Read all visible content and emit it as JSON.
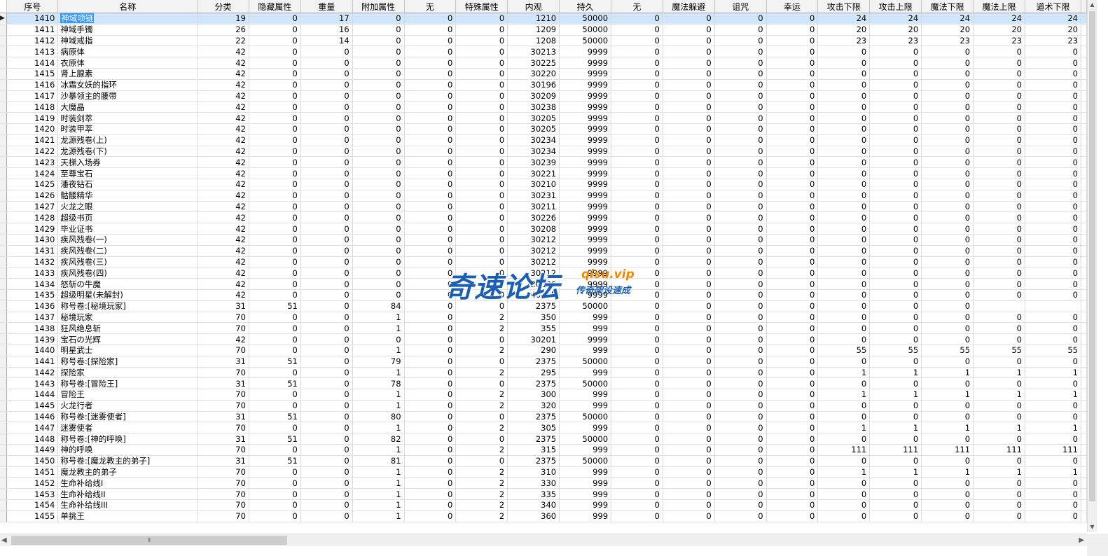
{
  "columns": [
    "序号",
    "名称",
    "分类",
    "隐藏属性",
    "重量",
    "附加属性",
    "无",
    "特殊属性",
    "内观",
    "持久",
    "无",
    "魔法躲避",
    "诅咒",
    "幸运",
    "攻击下限",
    "攻击上限",
    "魔法下限",
    "魔法上限",
    "道术下限"
  ],
  "active_row_index": 0,
  "rows": [
    [
      "1410",
      "神域项链",
      "19",
      "0",
      "17",
      "0",
      "0",
      "0",
      "1210",
      "50000",
      "0",
      "0",
      "0",
      "0",
      "24",
      "24",
      "24",
      "24",
      "24"
    ],
    [
      "1411",
      "神域手镯",
      "26",
      "0",
      "16",
      "0",
      "0",
      "0",
      "1209",
      "50000",
      "0",
      "0",
      "0",
      "0",
      "20",
      "20",
      "20",
      "20",
      "20"
    ],
    [
      "1412",
      "神域戒指",
      "22",
      "0",
      "14",
      "0",
      "0",
      "0",
      "1208",
      "50000",
      "0",
      "0",
      "0",
      "0",
      "23",
      "23",
      "23",
      "23",
      "23"
    ],
    [
      "1413",
      "病原体",
      "42",
      "0",
      "0",
      "0",
      "0",
      "0",
      "30213",
      "9999",
      "0",
      "0",
      "0",
      "0",
      "0",
      "0",
      "0",
      "0",
      "0"
    ],
    [
      "1414",
      "衣原体",
      "42",
      "0",
      "0",
      "0",
      "0",
      "0",
      "30225",
      "9999",
      "0",
      "0",
      "0",
      "0",
      "0",
      "0",
      "0",
      "0",
      "0"
    ],
    [
      "1415",
      "肾上腺素",
      "42",
      "0",
      "0",
      "0",
      "0",
      "0",
      "30220",
      "9999",
      "0",
      "0",
      "0",
      "0",
      "0",
      "0",
      "0",
      "0",
      "0"
    ],
    [
      "1416",
      "冰霜女妖的指环",
      "42",
      "0",
      "0",
      "0",
      "0",
      "0",
      "30196",
      "9999",
      "0",
      "0",
      "0",
      "0",
      "0",
      "0",
      "0",
      "0",
      "0"
    ],
    [
      "1417",
      "沙暴领主的腰带",
      "42",
      "0",
      "0",
      "0",
      "0",
      "0",
      "30209",
      "9999",
      "0",
      "0",
      "0",
      "0",
      "0",
      "0",
      "0",
      "0",
      "0"
    ],
    [
      "1418",
      "大魔晶",
      "42",
      "0",
      "0",
      "0",
      "0",
      "0",
      "30238",
      "9999",
      "0",
      "0",
      "0",
      "0",
      "0",
      "0",
      "0",
      "0",
      "0"
    ],
    [
      "1419",
      "时装剑萃",
      "42",
      "0",
      "0",
      "0",
      "0",
      "0",
      "30205",
      "9999",
      "0",
      "0",
      "0",
      "0",
      "0",
      "0",
      "0",
      "0",
      "0"
    ],
    [
      "1420",
      "时装甲萃",
      "42",
      "0",
      "0",
      "0",
      "0",
      "0",
      "30205",
      "9999",
      "0",
      "0",
      "0",
      "0",
      "0",
      "0",
      "0",
      "0",
      "0"
    ],
    [
      "1421",
      "龙源残卷(上)",
      "42",
      "0",
      "0",
      "0",
      "0",
      "0",
      "30234",
      "9999",
      "0",
      "0",
      "0",
      "0",
      "0",
      "0",
      "0",
      "0",
      "0"
    ],
    [
      "1422",
      "龙源残卷(下)",
      "42",
      "0",
      "0",
      "0",
      "0",
      "0",
      "30234",
      "9999",
      "0",
      "0",
      "0",
      "0",
      "0",
      "0",
      "0",
      "0",
      "0"
    ],
    [
      "1423",
      "天梯入场券",
      "42",
      "0",
      "0",
      "0",
      "0",
      "0",
      "30239",
      "9999",
      "0",
      "0",
      "0",
      "0",
      "0",
      "0",
      "0",
      "0",
      "0"
    ],
    [
      "1424",
      "至尊宝石",
      "42",
      "0",
      "0",
      "0",
      "0",
      "0",
      "30221",
      "9999",
      "0",
      "0",
      "0",
      "0",
      "0",
      "0",
      "0",
      "0",
      "0"
    ],
    [
      "1425",
      "潘夜钻石",
      "42",
      "0",
      "0",
      "0",
      "0",
      "0",
      "30210",
      "9999",
      "0",
      "0",
      "0",
      "0",
      "0",
      "0",
      "0",
      "0",
      "0"
    ],
    [
      "1426",
      "骷髅精华",
      "42",
      "0",
      "0",
      "0",
      "0",
      "0",
      "30231",
      "9999",
      "0",
      "0",
      "0",
      "0",
      "0",
      "0",
      "0",
      "0",
      "0"
    ],
    [
      "1427",
      "火龙之眼",
      "42",
      "0",
      "0",
      "0",
      "0",
      "0",
      "30211",
      "9999",
      "0",
      "0",
      "0",
      "0",
      "0",
      "0",
      "0",
      "0",
      "0"
    ],
    [
      "1428",
      "超级书页",
      "42",
      "0",
      "0",
      "0",
      "0",
      "0",
      "30226",
      "9999",
      "0",
      "0",
      "0",
      "0",
      "0",
      "0",
      "0",
      "0",
      "0"
    ],
    [
      "1429",
      "毕业证书",
      "42",
      "0",
      "0",
      "0",
      "0",
      "0",
      "30208",
      "9999",
      "0",
      "0",
      "0",
      "0",
      "0",
      "0",
      "0",
      "0",
      "0"
    ],
    [
      "1430",
      "疾风残卷(一)",
      "42",
      "0",
      "0",
      "0",
      "0",
      "0",
      "30212",
      "9999",
      "0",
      "0",
      "0",
      "0",
      "0",
      "0",
      "0",
      "0",
      "0"
    ],
    [
      "1431",
      "疾风残卷(二)",
      "42",
      "0",
      "0",
      "0",
      "0",
      "0",
      "30212",
      "9999",
      "0",
      "0",
      "0",
      "0",
      "0",
      "0",
      "0",
      "0",
      "0"
    ],
    [
      "1432",
      "疾风残卷(三)",
      "42",
      "0",
      "0",
      "0",
      "0",
      "0",
      "30212",
      "9999",
      "0",
      "0",
      "0",
      "0",
      "0",
      "0",
      "0",
      "0",
      "0"
    ],
    [
      "1433",
      "疾风残卷(四)",
      "42",
      "0",
      "0",
      "0",
      "0",
      "0",
      "30212",
      "9999",
      "0",
      "0",
      "0",
      "0",
      "0",
      "0",
      "0",
      "0",
      "0"
    ],
    [
      "1434",
      "怒斩の牛魔",
      "42",
      "0",
      "0",
      "0",
      "0",
      "0",
      "30206",
      "9999",
      "0",
      "0",
      "0",
      "0",
      "0",
      "0",
      "0",
      "0",
      "0"
    ],
    [
      "1435",
      "超级明星(未解封)",
      "42",
      "0",
      "0",
      "0",
      "0",
      "0",
      "40255",
      "9999",
      "0",
      "0",
      "0",
      "0",
      "0",
      "0",
      "0",
      "0",
      "0"
    ],
    [
      "1436",
      "称号卷:[秘境玩家]",
      "31",
      "51",
      "0",
      "84",
      "0",
      "0",
      "2375",
      "50000",
      "0",
      "0",
      "0",
      "0",
      "0",
      "0",
      "0",
      "",
      ""
    ],
    [
      "1437",
      "秘境玩家",
      "70",
      "0",
      "0",
      "1",
      "0",
      "2",
      "350",
      "999",
      "0",
      "0",
      "0",
      "0",
      "0",
      "0",
      "0",
      "0",
      "0"
    ],
    [
      "1438",
      "狂风绝息斩",
      "70",
      "0",
      "0",
      "1",
      "0",
      "2",
      "355",
      "999",
      "0",
      "0",
      "0",
      "0",
      "0",
      "0",
      "0",
      "0",
      "0"
    ],
    [
      "1439",
      "宝石の光辉",
      "42",
      "0",
      "0",
      "0",
      "0",
      "0",
      "30201",
      "9999",
      "0",
      "0",
      "0",
      "0",
      "0",
      "0",
      "0",
      "0",
      "0"
    ],
    [
      "1440",
      "明星武士",
      "70",
      "0",
      "0",
      "1",
      "0",
      "2",
      "290",
      "999",
      "0",
      "0",
      "0",
      "0",
      "55",
      "55",
      "55",
      "55",
      "55"
    ],
    [
      "1441",
      "称号卷:[探险家]",
      "31",
      "51",
      "0",
      "79",
      "0",
      "0",
      "2375",
      "50000",
      "0",
      "0",
      "0",
      "0",
      "0",
      "0",
      "0",
      "0",
      "0"
    ],
    [
      "1442",
      "探险家",
      "70",
      "0",
      "0",
      "1",
      "0",
      "2",
      "295",
      "999",
      "0",
      "0",
      "0",
      "0",
      "1",
      "1",
      "1",
      "1",
      "1"
    ],
    [
      "1443",
      "称号卷:[冒险王]",
      "31",
      "51",
      "0",
      "78",
      "0",
      "0",
      "2375",
      "50000",
      "0",
      "0",
      "0",
      "0",
      "0",
      "0",
      "0",
      "0",
      "0"
    ],
    [
      "1444",
      "冒险王",
      "70",
      "0",
      "0",
      "1",
      "0",
      "2",
      "300",
      "999",
      "0",
      "0",
      "0",
      "0",
      "1",
      "1",
      "1",
      "1",
      "1"
    ],
    [
      "1445",
      "火龙行者",
      "70",
      "0",
      "0",
      "1",
      "0",
      "2",
      "320",
      "999",
      "0",
      "0",
      "0",
      "0",
      "0",
      "0",
      "0",
      "0",
      "0"
    ],
    [
      "1446",
      "称号卷:[迷雾使者]",
      "31",
      "51",
      "0",
      "80",
      "0",
      "0",
      "2375",
      "50000",
      "0",
      "0",
      "0",
      "0",
      "0",
      "0",
      "0",
      "0",
      "0"
    ],
    [
      "1447",
      "迷雾使者",
      "70",
      "0",
      "0",
      "1",
      "0",
      "2",
      "305",
      "999",
      "0",
      "0",
      "0",
      "0",
      "1",
      "1",
      "1",
      "1",
      "1"
    ],
    [
      "1448",
      "称号卷:[神的呼唤]",
      "31",
      "51",
      "0",
      "82",
      "0",
      "0",
      "2375",
      "50000",
      "0",
      "0",
      "0",
      "0",
      "0",
      "0",
      "0",
      "0",
      "0"
    ],
    [
      "1449",
      "神的呼唤",
      "70",
      "0",
      "0",
      "1",
      "0",
      "2",
      "315",
      "999",
      "0",
      "0",
      "0",
      "0",
      "111",
      "111",
      "111",
      "111",
      "111"
    ],
    [
      "1450",
      "称号卷:[魔龙教主的弟子]",
      "31",
      "51",
      "0",
      "81",
      "0",
      "0",
      "2375",
      "50000",
      "0",
      "0",
      "0",
      "0",
      "0",
      "0",
      "0",
      "0",
      "0"
    ],
    [
      "1451",
      "魔龙教主的弟子",
      "70",
      "0",
      "0",
      "1",
      "0",
      "2",
      "310",
      "999",
      "0",
      "0",
      "0",
      "0",
      "1",
      "1",
      "1",
      "1",
      "1"
    ],
    [
      "1452",
      "生命补给线I",
      "70",
      "0",
      "0",
      "1",
      "0",
      "2",
      "330",
      "999",
      "0",
      "0",
      "0",
      "0",
      "0",
      "0",
      "0",
      "0",
      "0"
    ],
    [
      "1453",
      "生命补给线II",
      "70",
      "0",
      "0",
      "1",
      "0",
      "2",
      "335",
      "999",
      "0",
      "0",
      "0",
      "0",
      "0",
      "0",
      "0",
      "0",
      "0"
    ],
    [
      "1454",
      "生命补给线III",
      "70",
      "0",
      "0",
      "1",
      "0",
      "2",
      "340",
      "999",
      "0",
      "0",
      "0",
      "0",
      "0",
      "0",
      "0",
      "0",
      "0"
    ],
    [
      "1455",
      "单挑王",
      "70",
      "0",
      "0",
      "1",
      "0",
      "2",
      "360",
      "999",
      "0",
      "0",
      "0",
      "0",
      "0",
      "0",
      "0",
      "0",
      "0"
    ]
  ],
  "watermark": {
    "main": "奇速论坛",
    "url": "qisu.vip",
    "sub": "传奇架设速成"
  },
  "icons": {
    "row_selector": "triangle-right",
    "scroll_up": "arrow-up",
    "scroll_down": "arrow-down",
    "scroll_left": "arrow-left",
    "scroll_right": "arrow-right",
    "thumb_grip": "grip"
  },
  "colors": {
    "active_row": "#cfe6fb",
    "active_cell": "#3399ff",
    "header_bg": "#f3f3f3",
    "watermark_blue": "#1a5fb4",
    "watermark_orange": "#f08a00"
  }
}
